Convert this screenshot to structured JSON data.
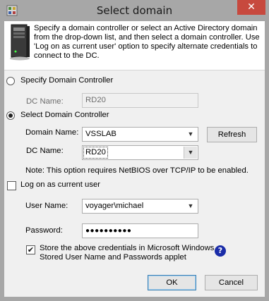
{
  "window": {
    "title": "Select domain",
    "close_symbol": "✕"
  },
  "header": {
    "text": "Specify a domain controller or select an Active Directory domain from the drop-down list, and then select a domain controller. Use 'Log on as current user' option to specify alternate credentials to connect to the DC."
  },
  "specify": {
    "radio_label": "Specify Domain Controller",
    "dc_name_label": "DC Name:",
    "dc_name_value": "RD20"
  },
  "select": {
    "radio_label": "Select Domain Controller",
    "domain_name_label": "Domain Name:",
    "domain_name_value": "VSSLAB",
    "refresh_label": "Refresh",
    "dc_name_label": "DC Name:",
    "dc_name_value": "RD20",
    "note": "Note: This option requires NetBIOS over TCP/IP to be enabled."
  },
  "logon": {
    "checkbox_label": "Log on as current user",
    "user_name_label": "User Name:",
    "user_name_value": "voyager\\michael",
    "password_label": "Password:",
    "password_value": "●●●●●●●●●●",
    "store_label_line1": "Store the above credentials in Microsoft Windows",
    "store_label_line2": "Stored User Name and Passwords applet"
  },
  "buttons": {
    "ok_label": "OK",
    "cancel_label": "Cancel"
  },
  "icons": {
    "app": "app-icon",
    "server": "server-icon",
    "help": "help-icon",
    "close": "close-icon",
    "dropdown": "chevron-down-icon"
  },
  "colors": {
    "titlebar": "#a7a7a7",
    "close": "#c7493e",
    "help": "#1a2ca8"
  }
}
